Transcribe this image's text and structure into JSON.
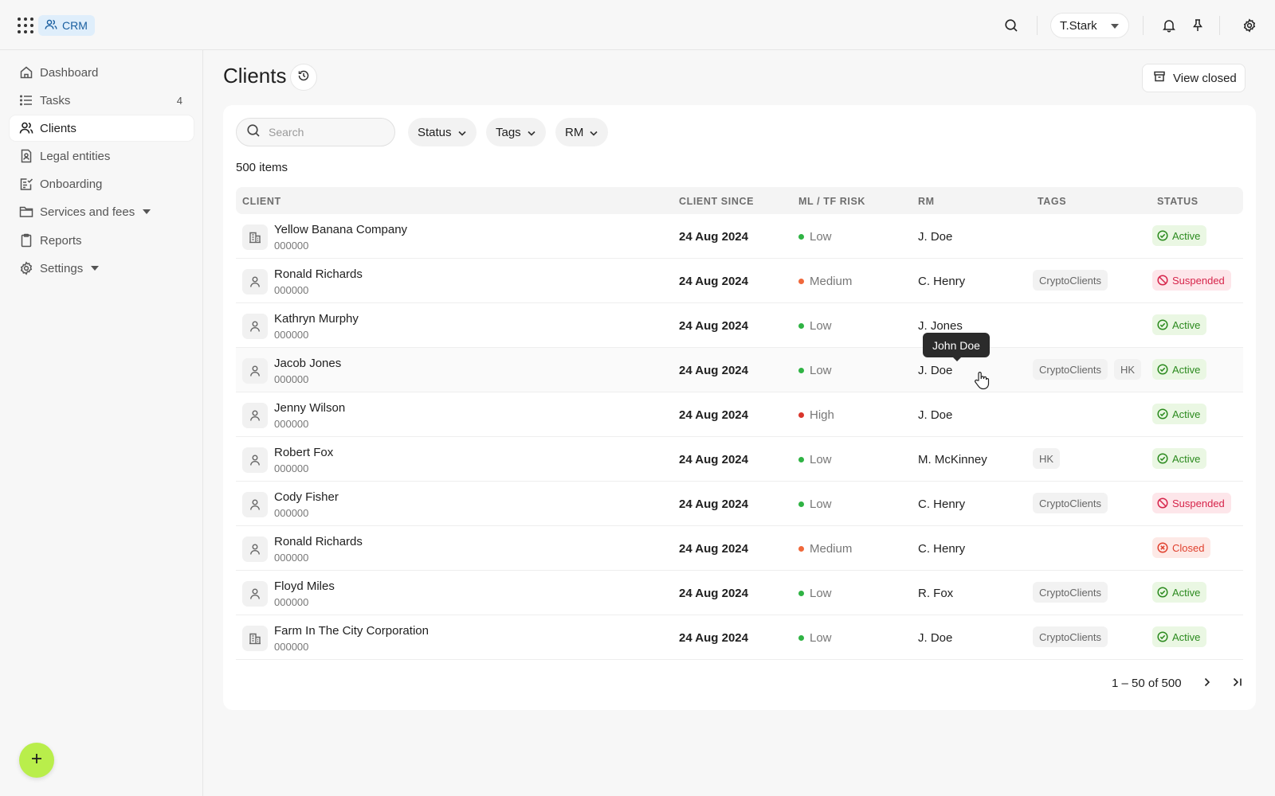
{
  "app": {
    "name": "CRM"
  },
  "user": {
    "name": "T.Stark"
  },
  "sidebar": {
    "items": [
      {
        "label": "Dashboard",
        "icon": "home-icon"
      },
      {
        "label": "Tasks",
        "icon": "list-icon",
        "count": "4"
      },
      {
        "label": "Clients",
        "icon": "users-icon",
        "active": true
      },
      {
        "label": "Legal entities",
        "icon": "document-icon"
      },
      {
        "label": "Onboarding",
        "icon": "checklist-icon"
      },
      {
        "label": "Services and fees",
        "icon": "folder-icon",
        "dropdown": true
      },
      {
        "label": "Reports",
        "icon": "clipboard-icon"
      },
      {
        "label": "Settings",
        "icon": "gear-icon",
        "dropdown": true
      }
    ]
  },
  "page": {
    "title": "Clients",
    "view_closed_label": "View closed"
  },
  "filters": {
    "search_placeholder": "Search",
    "status_label": "Status",
    "tags_label": "Tags",
    "rm_label": "RM"
  },
  "items_count": "500 items",
  "table": {
    "columns": [
      "CLIENT",
      "CLIENT SINCE",
      "ML / TF RISK",
      "RM",
      "TAGS",
      "STATUS"
    ],
    "rows": [
      {
        "name": "Yellow Banana Company",
        "id": "000000",
        "type": "company",
        "since": "24 Aug 2024",
        "risk": "Low",
        "rm": "J. Doe",
        "tags": [],
        "status": "Active"
      },
      {
        "name": "Ronald Richards",
        "id": "000000",
        "type": "person",
        "since": "24 Aug 2024",
        "risk": "Medium",
        "rm": "C. Henry",
        "tags": [
          "CryptoClients"
        ],
        "status": "Suspended"
      },
      {
        "name": "Kathryn Murphy",
        "id": "000000",
        "type": "person",
        "since": "24 Aug 2024",
        "risk": "Low",
        "rm": "J. Jones",
        "tags": [],
        "status": "Active"
      },
      {
        "name": "Jacob Jones",
        "id": "000000",
        "type": "person",
        "since": "24 Aug 2024",
        "risk": "Low",
        "rm": "J. Doe",
        "tags": [
          "CryptoClients",
          "HK"
        ],
        "status": "Active"
      },
      {
        "name": "Jenny Wilson",
        "id": "000000",
        "type": "person",
        "since": "24 Aug 2024",
        "risk": "High",
        "rm": "J. Doe",
        "tags": [],
        "status": "Active"
      },
      {
        "name": "Robert Fox",
        "id": "000000",
        "type": "person",
        "since": "24 Aug 2024",
        "risk": "Low",
        "rm": "M. McKinney",
        "tags": [
          "HK"
        ],
        "status": "Active"
      },
      {
        "name": "Cody Fisher",
        "id": "000000",
        "type": "person",
        "since": "24 Aug 2024",
        "risk": "Low",
        "rm": "C. Henry",
        "tags": [
          "CryptoClients"
        ],
        "status": "Suspended"
      },
      {
        "name": "Ronald Richards",
        "id": "000000",
        "type": "person",
        "since": "24 Aug 2024",
        "risk": "Medium",
        "rm": "C. Henry",
        "tags": [],
        "status": "Closed"
      },
      {
        "name": "Floyd Miles",
        "id": "000000",
        "type": "person",
        "since": "24 Aug 2024",
        "risk": "Low",
        "rm": "R. Fox",
        "tags": [
          "CryptoClients"
        ],
        "status": "Active"
      },
      {
        "name": "Farm In The City Corporation",
        "id": "000000",
        "type": "company",
        "since": "24 Aug 2024",
        "risk": "Low",
        "rm": "J. Doe",
        "tags": [
          "CryptoClients"
        ],
        "status": "Active"
      }
    ]
  },
  "tooltip": {
    "text": "John Doe"
  },
  "pagination": {
    "text": "1 – 50 of 500"
  },
  "colors": {
    "risk_low": "#2fb344",
    "risk_medium": "#f0683b",
    "risk_high": "#d9352b",
    "status_active_bg": "#eaf7e3",
    "status_active_fg": "#2b8a1e",
    "status_suspended_bg": "#fde6ea",
    "status_suspended_fg": "#d6244a",
    "status_closed_bg": "#fde9e6",
    "status_closed_fg": "#e0412e",
    "fab": "#b9ee4b"
  }
}
